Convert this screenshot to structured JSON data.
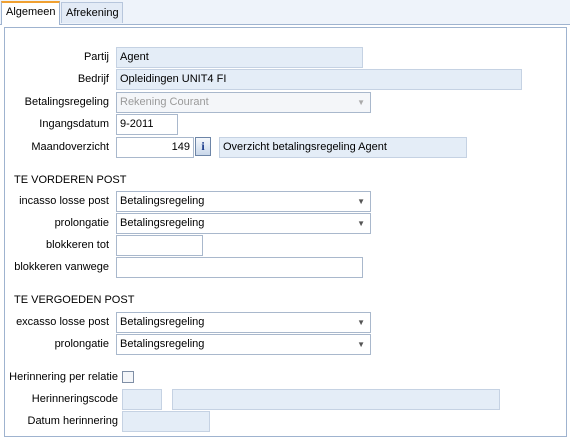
{
  "tabs": [
    {
      "label": "Algemeen"
    },
    {
      "label": "Afrekening"
    }
  ],
  "fields": {
    "partij": {
      "label": "Partij",
      "value": "Agent"
    },
    "bedrijf": {
      "label": "Bedrijf",
      "value": "Opleidingen UNIT4 FI"
    },
    "betalingsregeling": {
      "label": "Betalingsregeling",
      "value": "Rekening Courant"
    },
    "ingangsdatum": {
      "label": "Ingangsdatum",
      "value": "9-2011"
    },
    "maandoverzicht": {
      "label": "Maandoverzicht",
      "value": "149",
      "info": "i",
      "description": "Overzicht betalingsregeling Agent"
    }
  },
  "te_vorderen": {
    "title": "TE VORDEREN POST",
    "incasso": {
      "label": "incasso losse post",
      "value": "Betalingsregeling"
    },
    "prolongatie": {
      "label": "prolongatie",
      "value": "Betalingsregeling"
    },
    "blokkeren_tot": {
      "label": "blokkeren tot",
      "value": ""
    },
    "blokkeren_vanwege": {
      "label": "blokkeren vanwege",
      "value": ""
    }
  },
  "te_vergoeden": {
    "title": "TE VERGOEDEN POST",
    "excasso": {
      "label": "excasso losse post",
      "value": "Betalingsregeling"
    },
    "prolongatie": {
      "label": "prolongatie",
      "value": "Betalingsregeling"
    }
  },
  "herinnering": {
    "per_relatie": {
      "label": "Herinnering per relatie",
      "checked": false
    },
    "code": {
      "label": "Herinneringscode",
      "value": "",
      "description": ""
    },
    "datum": {
      "label": "Datum herinnering",
      "value": ""
    }
  },
  "icons": {
    "dropdown": "chevron-down-icon",
    "info": "info-icon"
  }
}
